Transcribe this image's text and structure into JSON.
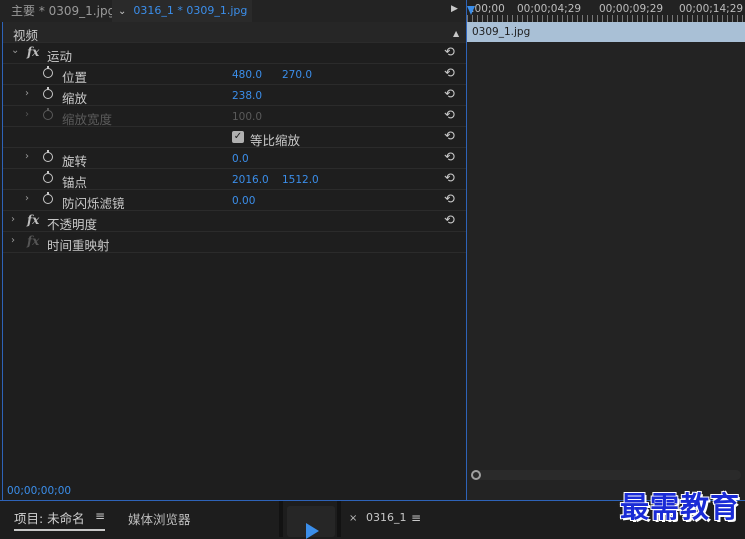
{
  "tabs": {
    "main_label": "主要 * 0309_1.jpg",
    "sequence_label": "0316_1 * 0309_1.jpg"
  },
  "effects": {
    "section_header": "视频",
    "motion": {
      "label": "运动",
      "position": {
        "label": "位置",
        "x": "480.0",
        "y": "270.0"
      },
      "scale": {
        "label": "缩放",
        "value": "238.0"
      },
      "scale_width": {
        "label": "缩放宽度",
        "value": "100.0"
      },
      "uniform_scale": {
        "label": "等比缩放",
        "checked": true
      },
      "rotation": {
        "label": "旋转",
        "value": "0.0"
      },
      "anchor": {
        "label": "锚点",
        "x": "2016.0",
        "y": "1512.0"
      },
      "anti_flicker": {
        "label": "防闪烁滤镜",
        "value": "0.00"
      }
    },
    "opacity": {
      "label": "不透明度"
    },
    "time_remap": {
      "label": "时间重映射"
    },
    "timecode": "00;00;00;00"
  },
  "timeline": {
    "ruler_labels": [
      ":00;00",
      "00;00;04;29",
      "00;00;09;29",
      "00;00;14;29"
    ],
    "clip_name": "0309_1.jpg"
  },
  "bottom": {
    "project_tab": "项目: 未命名",
    "media_browser_tab": "媒体浏览器",
    "sequence_tab": "0316_1"
  },
  "watermark": "最需教育",
  "icons": {
    "menu": "≡",
    "close": "×",
    "reset": "⟲",
    "expand": "›",
    "collapse": "⌄"
  },
  "colors": {
    "accent": "#3b8eea",
    "clip": "#a9c0d6",
    "watermark": "#1a2bd6"
  }
}
